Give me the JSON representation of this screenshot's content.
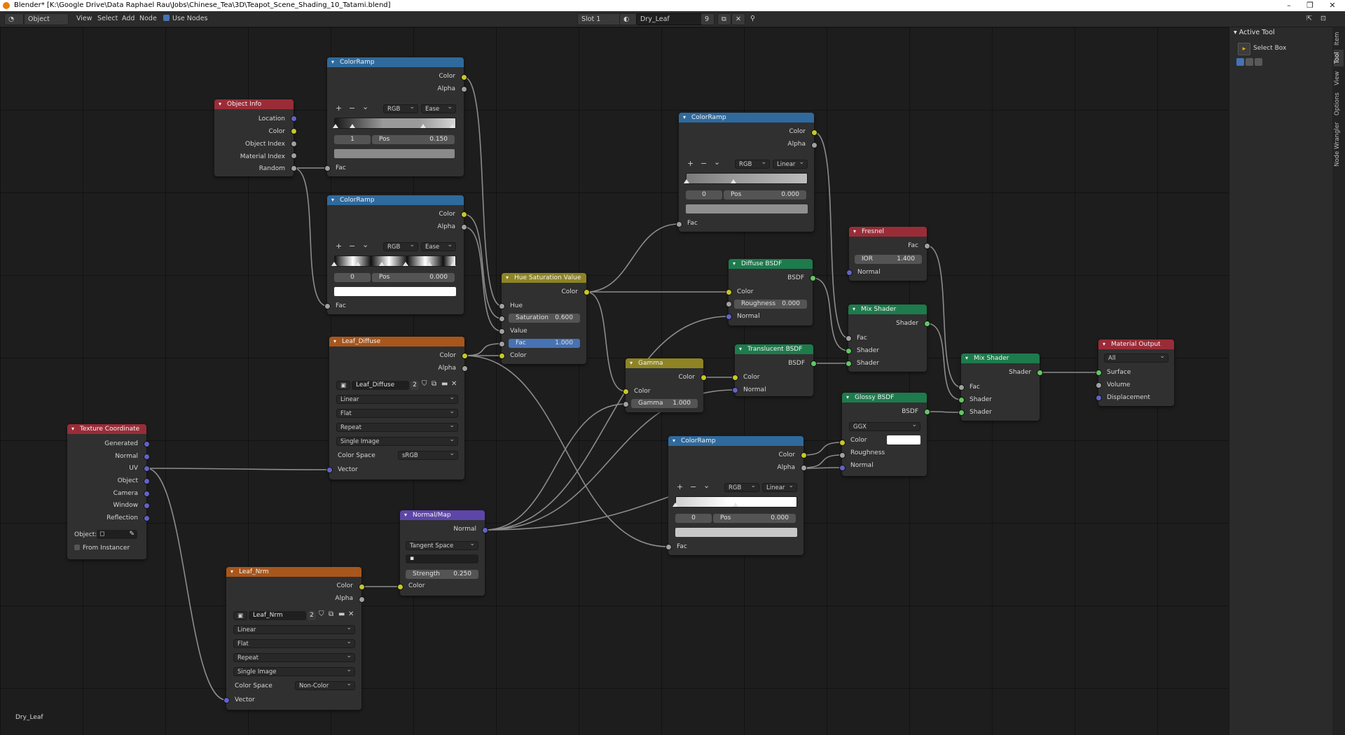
{
  "window": {
    "title": "Blender* [K:\\Google Drive\\Data Raphael Rau\\Jobs\\Chinese_Tea\\3D\\Teapot_Scene_Shading_10_Tatami.blend]"
  },
  "header": {
    "mode": "Object",
    "menus": [
      "View",
      "Select",
      "Add",
      "Node"
    ],
    "use_nodes": "Use Nodes",
    "slot": "Slot 1",
    "material": "Dry_Leaf",
    "users": "9"
  },
  "sidebar": {
    "title": "Active Tool",
    "tool_name": "Select Box",
    "tabs": [
      "Item",
      "Tool",
      "View",
      "Options",
      "Node Wrangler"
    ]
  },
  "editor": {
    "material_label": "Dry_Leaf"
  },
  "nodes": {
    "object_info": {
      "title": "Object Info",
      "outputs": [
        "Location",
        "Color",
        "Object Index",
        "Material Index",
        "Random"
      ]
    },
    "colorramp1": {
      "title": "ColorRamp",
      "outputs": [
        "Color",
        "Alpha"
      ],
      "mode": "RGB",
      "interp": "Ease",
      "index": "1",
      "pos_label": "Pos",
      "pos": "0.150",
      "input": "Fac"
    },
    "colorramp2": {
      "title": "ColorRamp",
      "outputs": [
        "Color",
        "Alpha"
      ],
      "mode": "RGB",
      "interp": "Ease",
      "index": "0",
      "pos_label": "Pos",
      "pos": "0.000",
      "input": "Fac"
    },
    "colorramp3": {
      "title": "ColorRamp",
      "outputs": [
        "Color",
        "Alpha"
      ],
      "mode": "RGB",
      "interp": "Linear",
      "index": "0",
      "pos_label": "Pos",
      "pos": "0.000",
      "input": "Fac"
    },
    "colorramp4": {
      "title": "ColorRamp",
      "outputs": [
        "Color",
        "Alpha"
      ],
      "mode": "RGB",
      "interp": "Linear",
      "index": "0",
      "pos_label": "Pos",
      "pos": "0.000",
      "input": "Fac"
    },
    "hsv": {
      "title": "Hue Saturation Value",
      "output": "Color",
      "hue": "Hue",
      "sat_label": "Saturation",
      "sat": "0.600",
      "value": "Value",
      "fac_label": "Fac",
      "fac": "1.000",
      "color": "Color"
    },
    "leaf_diffuse": {
      "title": "Leaf_Diffuse",
      "outputs": [
        "Color",
        "Alpha"
      ],
      "image": "Leaf_Diffuse",
      "users": "2",
      "interp": "Linear",
      "proj": "Flat",
      "ext": "Repeat",
      "source": "Single Image",
      "cs_label": "Color Space",
      "cs": "sRGB",
      "input": "Vector"
    },
    "leaf_nrm": {
      "title": "Leaf_Nrm",
      "outputs": [
        "Color",
        "Alpha"
      ],
      "image": "Leaf_Nrm",
      "users": "2",
      "interp": "Linear",
      "proj": "Flat",
      "ext": "Repeat",
      "source": "Single Image",
      "cs_label": "Color Space",
      "cs": "Non-Color",
      "input": "Vector"
    },
    "texcoord": {
      "title": "Texture Coordinate",
      "outputs": [
        "Generated",
        "Normal",
        "UV",
        "Object",
        "Camera",
        "Window",
        "Reflection"
      ],
      "object_label": "Object:",
      "instancer": "From Instancer"
    },
    "normalmap": {
      "title": "Normal/Map",
      "output": "Normal",
      "space": "Tangent Space",
      "strength_label": "Strength",
      "strength": "0.250",
      "input": "Color"
    },
    "gamma": {
      "title": "Gamma",
      "output": "Color",
      "input": "Color",
      "gamma_label": "Gamma",
      "gamma": "1.000"
    },
    "diffuse": {
      "title": "Diffuse BSDF",
      "output": "BSDF",
      "color": "Color",
      "rough_label": "Roughness",
      "rough": "0.000",
      "normal": "Normal"
    },
    "translucent": {
      "title": "Translucent BSDF",
      "output": "BSDF",
      "color": "Color",
      "normal": "Normal"
    },
    "fresnel": {
      "title": "Fresnel",
      "output": "Fac",
      "ior_label": "IOR",
      "ior": "1.400",
      "normal": "Normal"
    },
    "mix1": {
      "title": "Mix Shader",
      "output": "Shader",
      "inputs": [
        "Fac",
        "Shader",
        "Shader"
      ]
    },
    "mix2": {
      "title": "Mix Shader",
      "output": "Shader",
      "inputs": [
        "Fac",
        "Shader",
        "Shader"
      ]
    },
    "glossy": {
      "title": "Glossy BSDF",
      "output": "BSDF",
      "dist": "GGX",
      "color": "Color",
      "rough": "Roughness",
      "normal": "Normal"
    },
    "output": {
      "title": "Material Output",
      "target": "All",
      "inputs": [
        "Surface",
        "Volume",
        "Displacement"
      ]
    }
  },
  "colors": {
    "colorramp_header": "#2f6a9d",
    "input_header": "#9a2c38",
    "texture_header": "#a8561c",
    "color_header": "#8e8424",
    "shader_header": "#1d7b4c",
    "vector_header": "#5d46a7"
  }
}
